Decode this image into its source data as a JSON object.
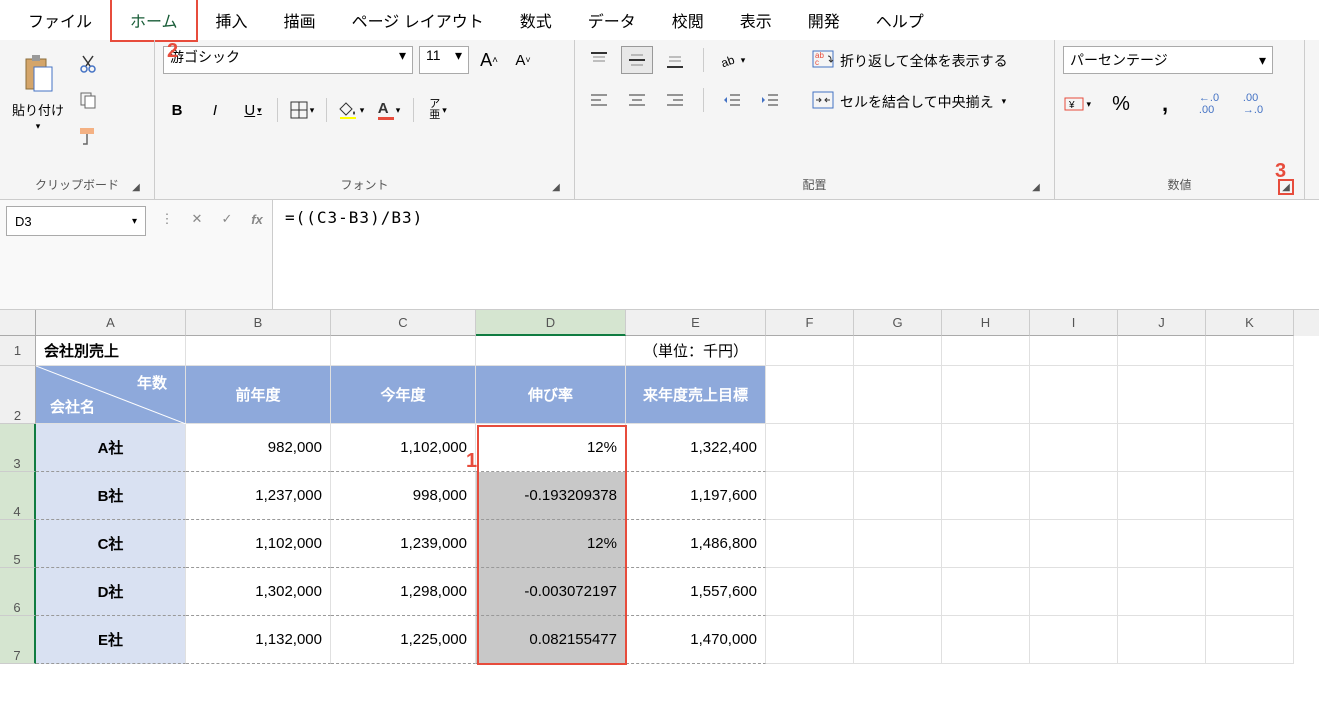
{
  "menu": {
    "items": [
      "ファイル",
      "ホーム",
      "挿入",
      "描画",
      "ページ レイアウト",
      "数式",
      "データ",
      "校閲",
      "表示",
      "開発",
      "ヘルプ"
    ],
    "active_index": 1
  },
  "ribbon": {
    "clipboard": {
      "label": "クリップボード",
      "paste_label": "貼り付け"
    },
    "font": {
      "label": "フォント",
      "name": "游ゴシック",
      "size": "11"
    },
    "alignment": {
      "label": "配置",
      "wrap_text": "折り返して全体を表示する",
      "merge_center": "セルを結合して中央揃え"
    },
    "number": {
      "label": "数値",
      "format": "パーセンテージ"
    }
  },
  "annotations": {
    "a1": "1",
    "a2": "2",
    "a3": "3"
  },
  "formula_bar": {
    "cell_ref": "D3",
    "formula": "=((C3-B3)/B3)"
  },
  "sheet": {
    "columns": [
      "A",
      "B",
      "C",
      "D",
      "E",
      "F",
      "G",
      "H",
      "I",
      "J",
      "K"
    ],
    "title": "会社別売上",
    "unit": "（単位：千円）",
    "header_corner_top": "年数",
    "header_corner_bottom": "会社名",
    "headers": [
      "前年度",
      "今年度",
      "伸び率",
      "来年度売上目標"
    ],
    "rows": [
      {
        "name": "A社",
        "prev": "982,000",
        "curr": "1,102,000",
        "rate": "12%",
        "target": "1,322,400"
      },
      {
        "name": "B社",
        "prev": "1,237,000",
        "curr": "998,000",
        "rate": "-0.193209378",
        "target": "1,197,600"
      },
      {
        "name": "C社",
        "prev": "1,102,000",
        "curr": "1,239,000",
        "rate": "12%",
        "target": "1,486,800"
      },
      {
        "name": "D社",
        "prev": "1,302,000",
        "curr": "1,298,000",
        "rate": "-0.003072197",
        "target": "1,557,600"
      },
      {
        "name": "E社",
        "prev": "1,132,000",
        "curr": "1,225,000",
        "rate": "0.082155477",
        "target": "1,470,000"
      }
    ]
  }
}
